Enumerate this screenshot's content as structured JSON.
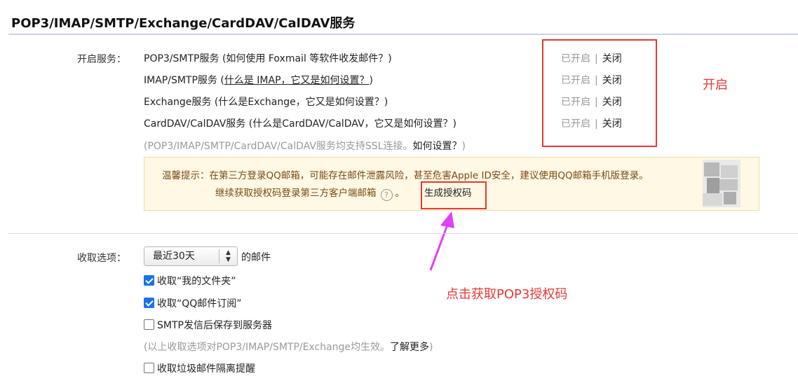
{
  "section": {
    "title": "POP3/IMAP/SMTP/Exchange/CardDAV/CalDAV服务"
  },
  "services": {
    "label": "开启服务：",
    "rows": [
      {
        "name": "POP3/SMTP服务",
        "help": "(如何使用 Foxmail 等软件收发邮件？)",
        "help_underlined": false,
        "status_on": "已开启",
        "separator": "|",
        "status_off": "关闭"
      },
      {
        "name": "IMAP/SMTP服务",
        "help_open": "(",
        "help": "什么是 IMAP，它又是如何设置？",
        "help_close": ")",
        "help_underlined": true,
        "status_on": "已开启",
        "separator": "|",
        "status_off": "关闭"
      },
      {
        "name": "Exchange服务",
        "help": "(什么是Exchange，它又是如何设置？)",
        "help_underlined": false,
        "status_on": "已开启",
        "separator": "|",
        "status_off": "关闭"
      },
      {
        "name": "CardDAV/CalDAV服务",
        "help": "(什么是CardDAV/CalDAV，它又是如何设置？)",
        "help_underlined": false,
        "status_on": "已开启",
        "separator": "|",
        "status_off": "关闭"
      }
    ],
    "ssl_note": "(POP3/IMAP/SMTP/CardDAV/CalDAV服务均支持SSL连接。",
    "ssl_note_link": "如何设置？",
    "ssl_note_close": ")"
  },
  "tip": {
    "line1": "温馨提示：在第三方登录QQ邮箱，可能存在邮件泄露风险，甚至危害Apple ID安全，建议使用QQ邮箱手机版登录。",
    "line2": "继续获取授权码登录第三方客户端邮箱",
    "help_glyph": "?",
    "period": "。",
    "generate_link": "生成授权码"
  },
  "annotations": {
    "enable_label": "开启",
    "click_label": "点击获取POP3授权码",
    "color": "#e53935",
    "arrow_color": "#e040fb"
  },
  "receive": {
    "label": "收取选项：",
    "select_value": "最近30天",
    "select_suffix": "的邮件",
    "checkboxes": [
      {
        "label": "收取“我的文件夹”",
        "checked": true
      },
      {
        "label": "收取“QQ邮件订阅”",
        "checked": true
      },
      {
        "label": "SMTP发信后保存到服务器",
        "checked": false
      }
    ],
    "note": "(以上收取选项对POP3/IMAP/SMTP/Exchange均生效。",
    "note_link": "了解更多",
    "note_close": ")",
    "last_checkbox": {
      "label": "收取垃圾邮件隔离提醒",
      "checked": false
    }
  },
  "colors": {
    "checkbox_checked": "#1a73e8",
    "tip_background": "#fff8e4",
    "tip_text": "#7a4a12",
    "muted_text": "#999999"
  }
}
